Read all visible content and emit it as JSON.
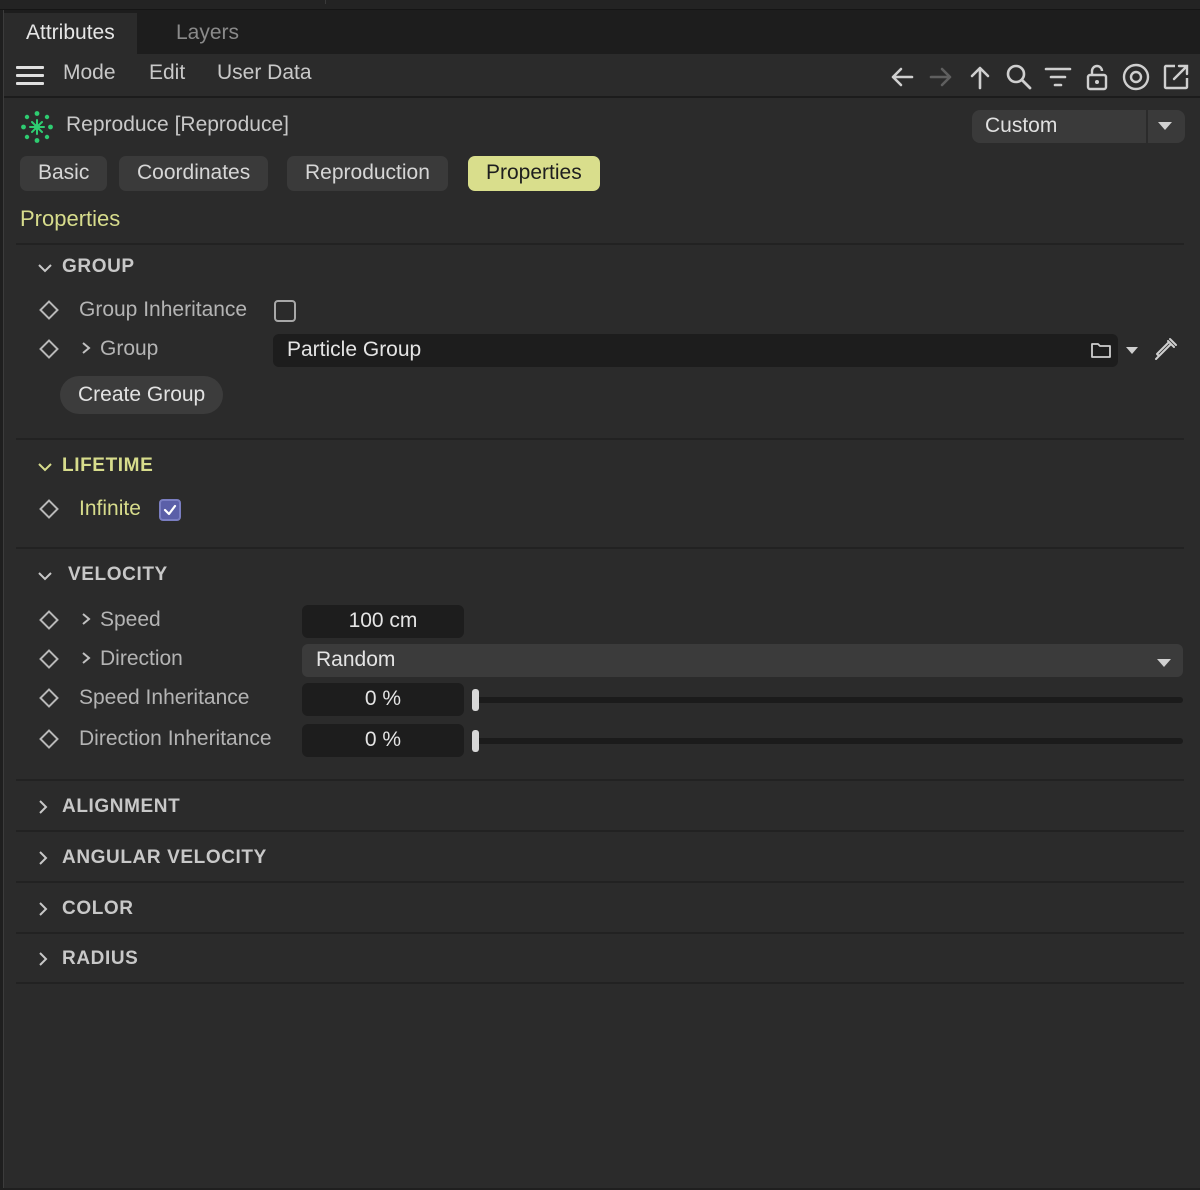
{
  "tabs": {
    "attributes": "Attributes",
    "layers": "Layers"
  },
  "menu": {
    "mode": "Mode",
    "edit": "Edit",
    "user_data": "User Data"
  },
  "toolbar_icons": [
    "arrow-left-icon",
    "arrow-right-icon",
    "arrow-up-icon",
    "search-icon",
    "filter-icon",
    "lock-icon",
    "target-icon",
    "external-link-icon"
  ],
  "object": {
    "title": "Reproduce [Reproduce]",
    "icon": "particle-emitter-icon",
    "icon_color": "#2ecc71"
  },
  "layout_select": {
    "value": "Custom"
  },
  "page_tabs": {
    "basic": "Basic",
    "coordinates": "Coordinates",
    "reproduction": "Reproduction",
    "properties": "Properties"
  },
  "section_title": "Properties",
  "group": {
    "header": "GROUP",
    "group_inheritance_label": "Group Inheritance",
    "group_inheritance_checked": false,
    "group_label": "Group",
    "group_value": "Particle Group",
    "create_group": "Create Group"
  },
  "lifetime": {
    "header": "LIFETIME",
    "infinite_label": "Infinite",
    "infinite_checked": true
  },
  "velocity": {
    "header": "VELOCITY",
    "speed_label": "Speed",
    "speed_value": "100 cm",
    "direction_label": "Direction",
    "direction_value": "Random",
    "speed_inheritance_label": "Speed Inheritance",
    "speed_inheritance_value": "0 %",
    "speed_inheritance_level": 0,
    "direction_inheritance_label": "Direction Inheritance",
    "direction_inheritance_value": "0 %",
    "direction_inheritance_level": 0
  },
  "collapsed_groups": {
    "alignment": "ALIGNMENT",
    "angular_velocity": "ANGULAR VELOCITY",
    "color": "COLOR",
    "radius": "RADIUS"
  },
  "colors": {
    "accent": "#d9de8c",
    "checkbox_checked": "#5b5fa8",
    "panel": "#2b2b2b"
  }
}
